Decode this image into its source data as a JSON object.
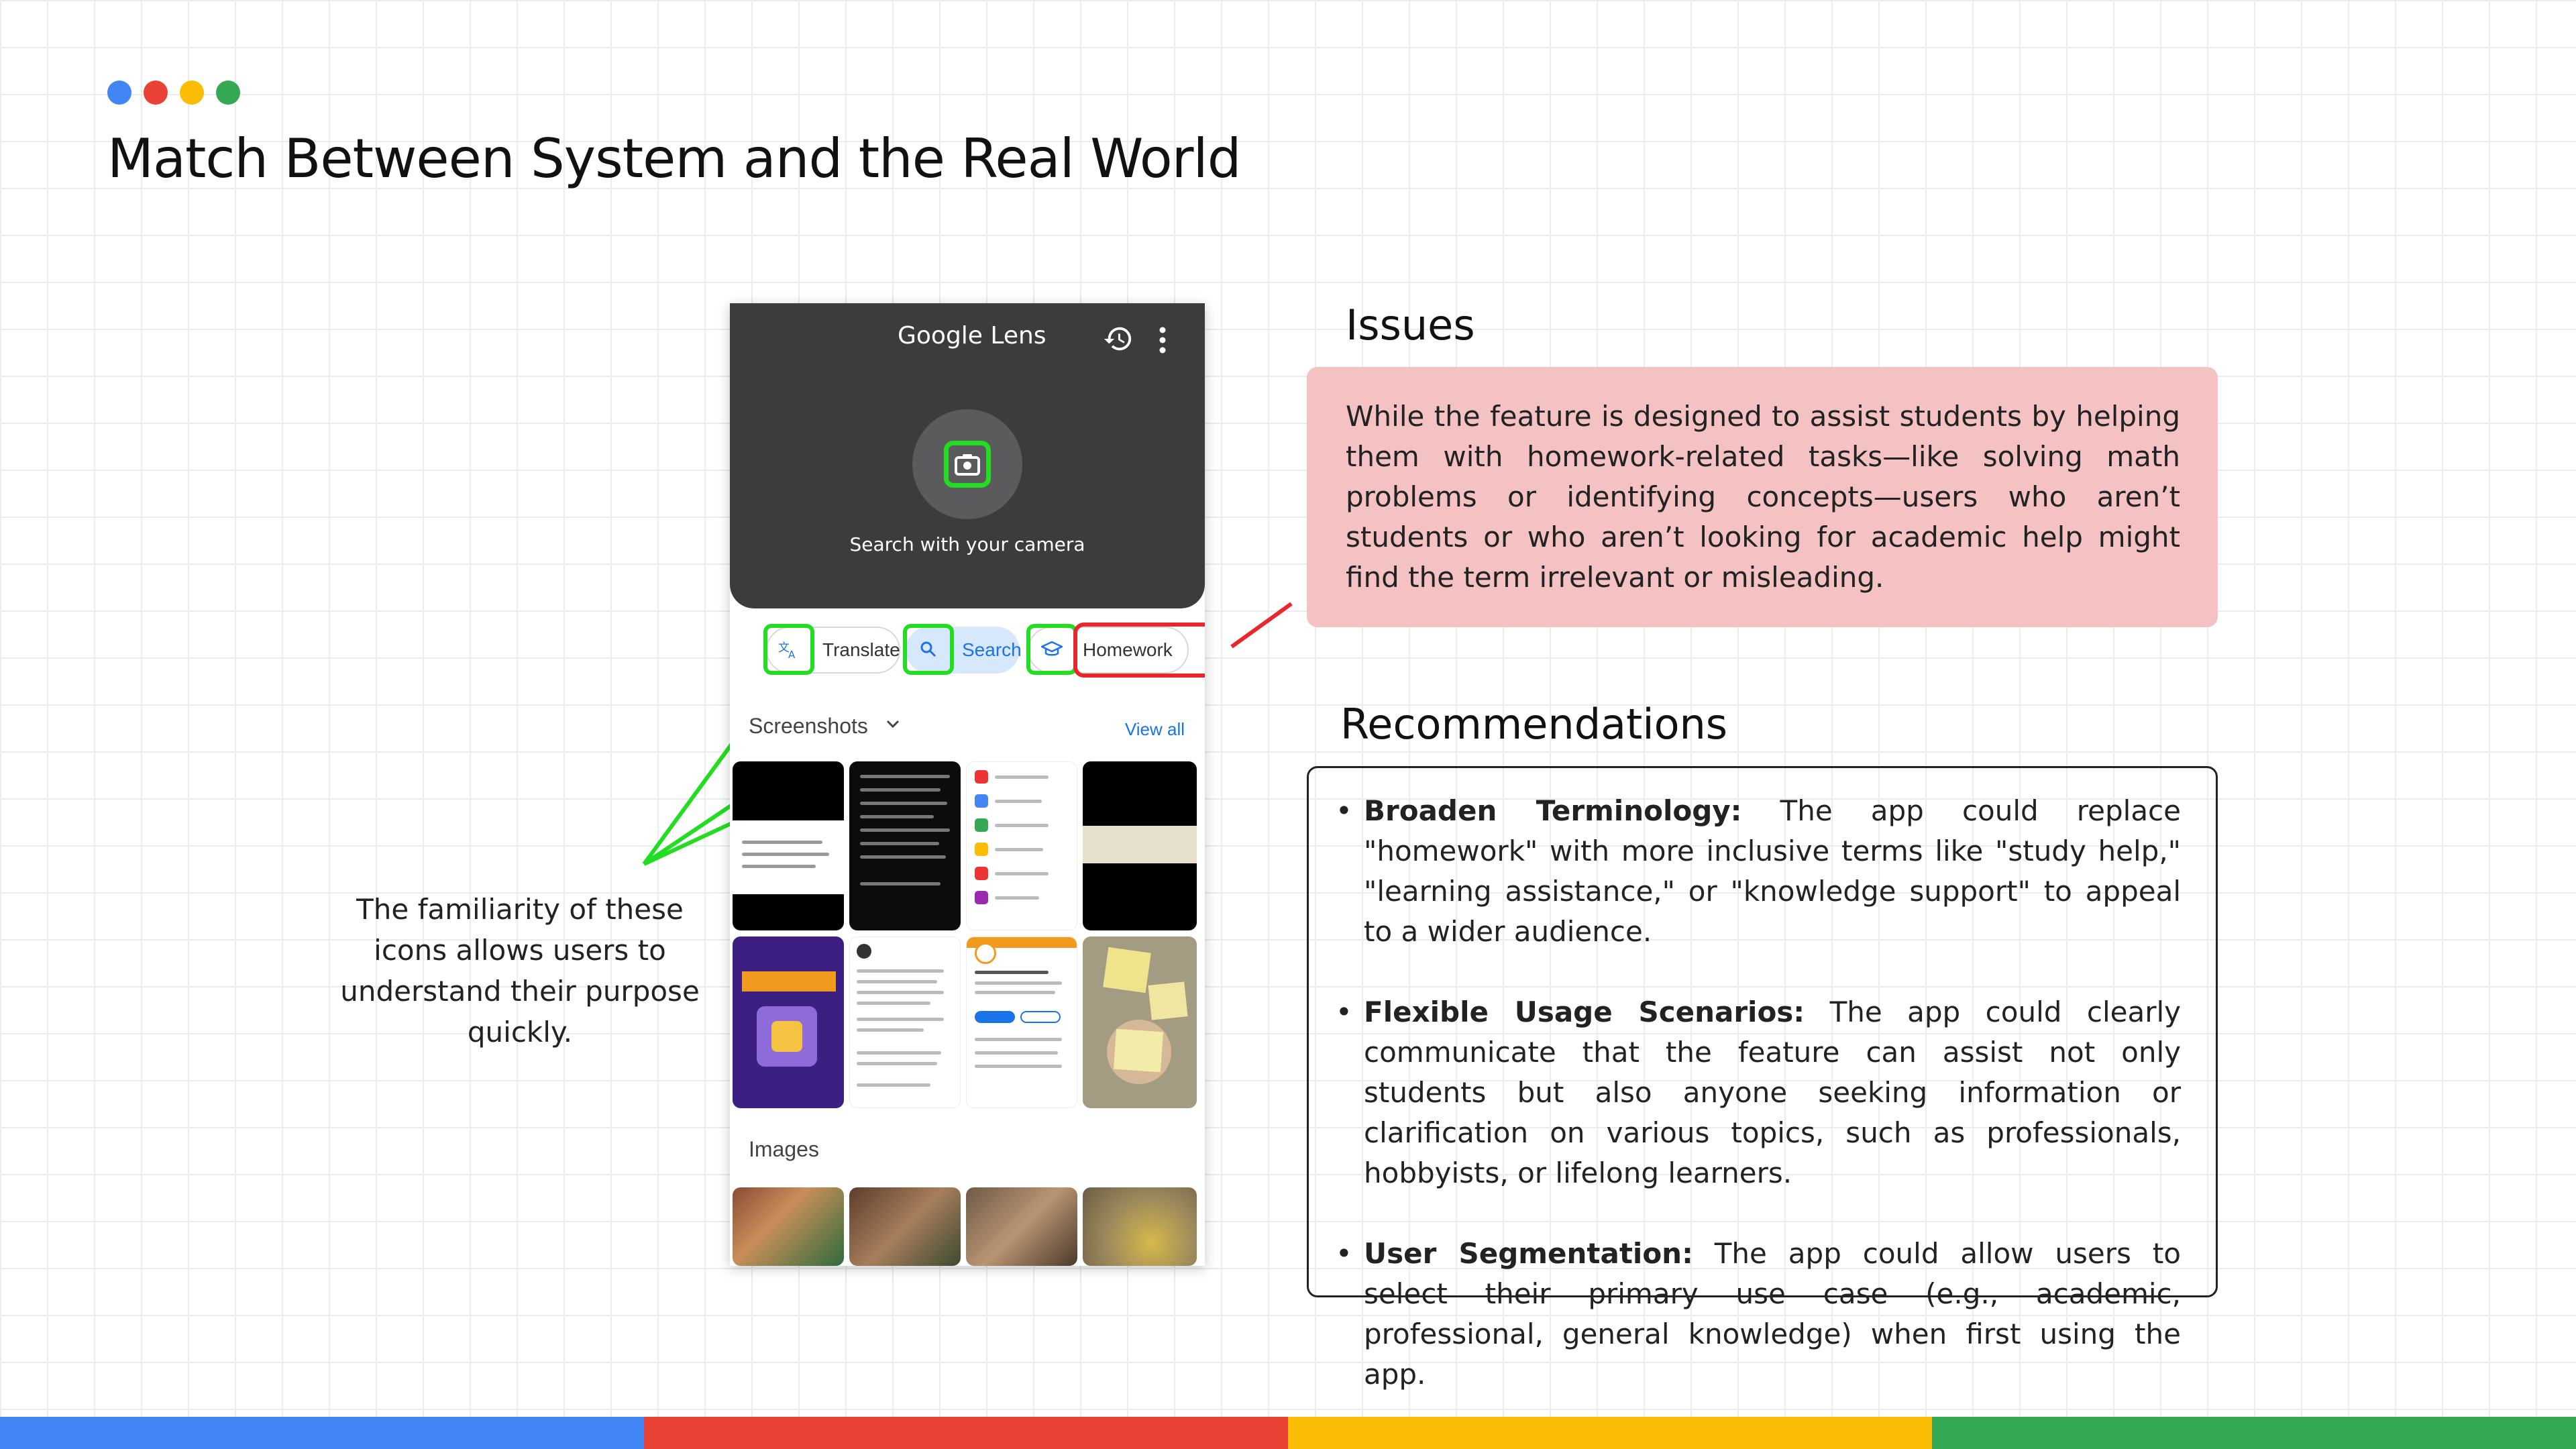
{
  "slide": {
    "title": "Match Between System and the Real World",
    "dot_colors": [
      "#4285f4",
      "#ea4335",
      "#fbbc05",
      "#34a853"
    ],
    "bar_colors": [
      "#4285f4",
      "#ea4335",
      "#fbbc05",
      "#34a853"
    ]
  },
  "phone": {
    "app_title": "Google Lens",
    "camera_label": "Search with your camera",
    "chips": {
      "translate": "Translate",
      "search": "Search",
      "homework": "Homework"
    },
    "screenshots": {
      "heading": "Screenshots",
      "view_all": "View all"
    },
    "images": {
      "heading": "Images"
    },
    "highlight_colors": {
      "familiar": "#22dd22",
      "issue": "#e8262c"
    }
  },
  "caption": "The familiarity of these icons allows users to understand their purpose quickly.",
  "issues": {
    "heading": "Issues",
    "text": "While the feature is designed to assist students by helping them with homework-related tasks—like solving math problems or identifying concepts—users who aren’t students or who aren’t looking for academic help might find the term irrelevant or misleading."
  },
  "recommendations": {
    "heading": "Recommendations",
    "items": [
      {
        "title": "Broaden Terminology:",
        "text": " The app could replace \"homework\" with more inclusive terms like \"study help,\" \"learning assistance,\" or \"knowledge support\" to appeal to a wider audience."
      },
      {
        "title": "Flexible Usage Scenarios:",
        "text": " The app could clearly communicate that the feature can assist not only students but also anyone seeking information or clarification on various topics, such as professionals, hobbyists, or lifelong learners."
      },
      {
        "title": "User Segmentation:",
        "text": " The app could allow users to select their primary use case (e.g., academic, professional, general knowledge) when first using the app."
      }
    ]
  }
}
